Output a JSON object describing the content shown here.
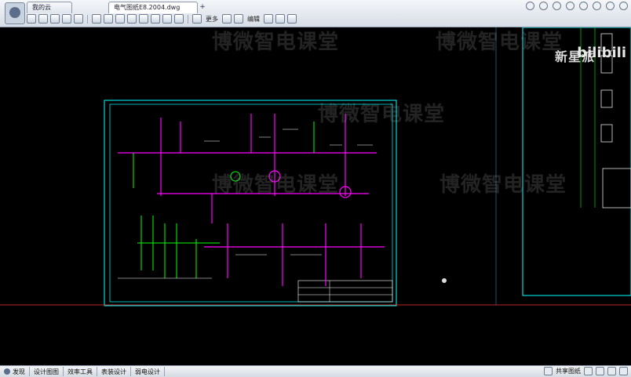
{
  "tabs": {
    "home": "我的云",
    "document": "电气图纸E8.2004.dwg"
  },
  "toolbar": {
    "more_label": "更多",
    "edit_label": "编辑"
  },
  "watermarks": {
    "brand_overlay": "新星派",
    "platform_overlay": "bilibili",
    "course": "博微智电课堂"
  },
  "statusbar": {
    "items": [
      "发现",
      "设计图图",
      "效率工具",
      "表装设计",
      "弱电设计"
    ],
    "share_label": "共享图纸"
  },
  "colors": {
    "canvas": "#000000",
    "frame": "#00ffff",
    "wire_magenta": "#ff00ff",
    "wire_green": "#00ff00",
    "text_white": "#ffffff"
  }
}
